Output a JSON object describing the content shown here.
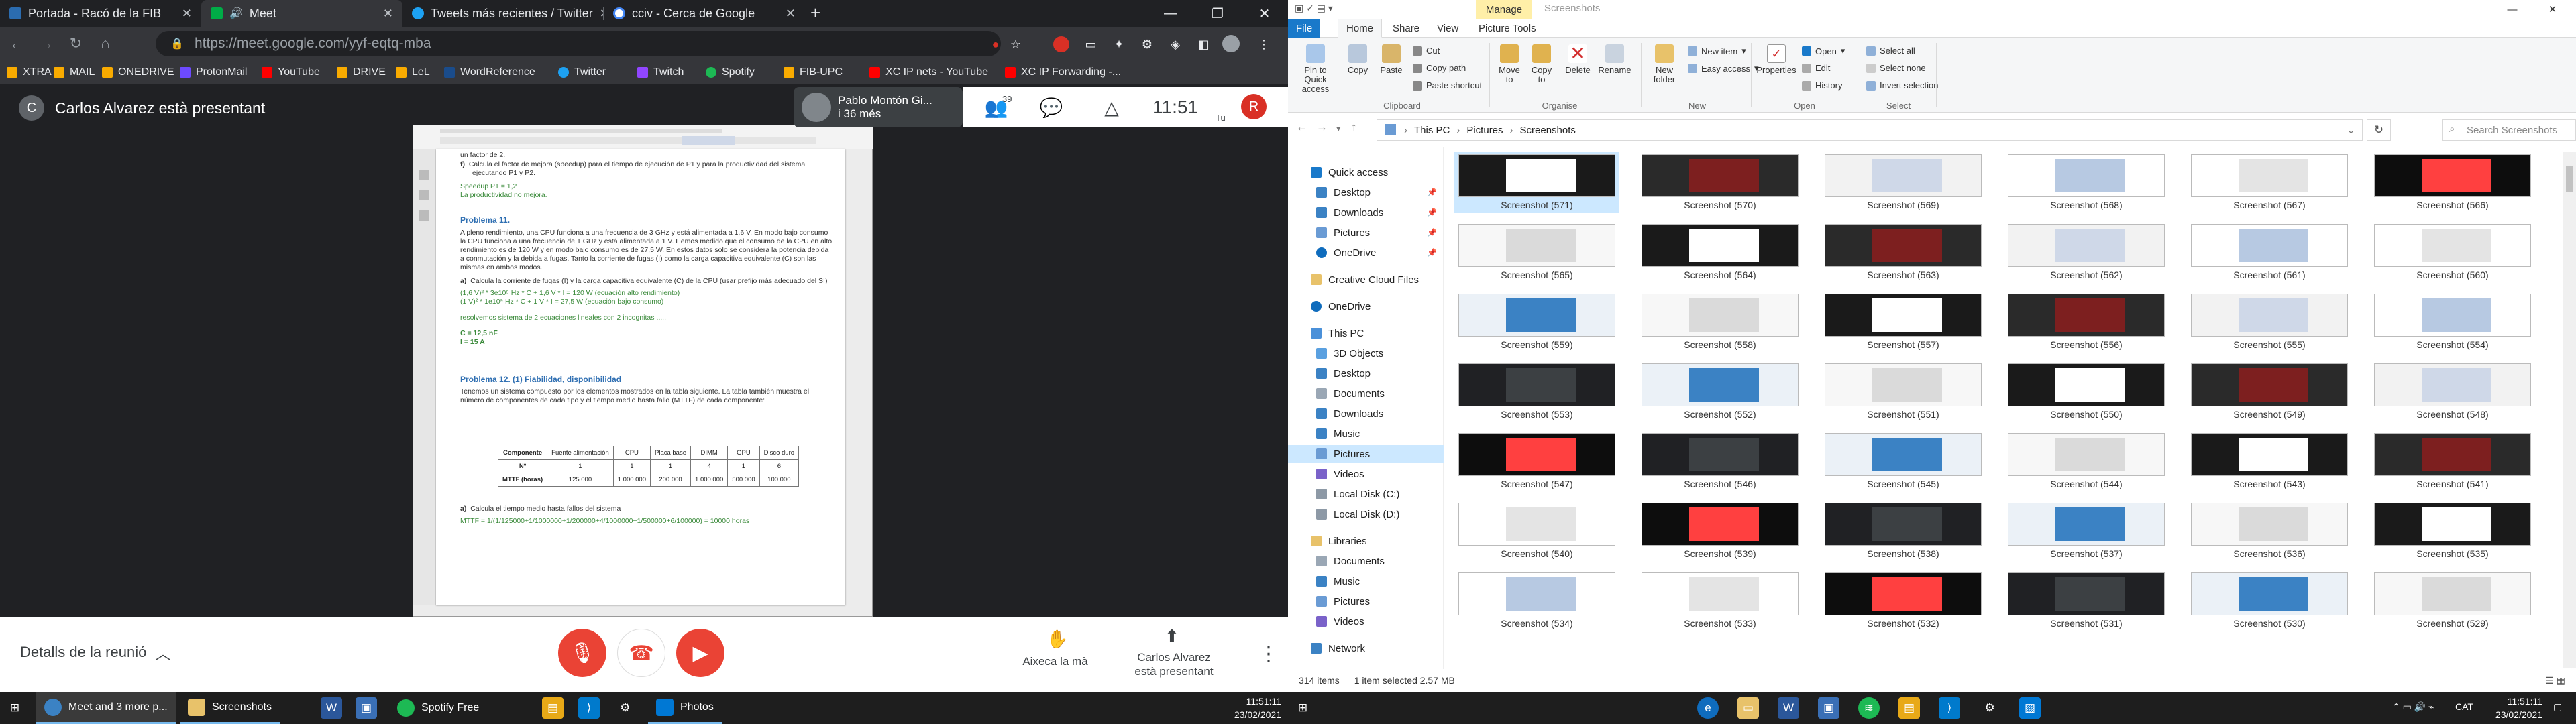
{
  "browser": {
    "tabs": [
      {
        "title": "Portada - Racó de la FIB",
        "active": false
      },
      {
        "title": "Meet",
        "active": true
      },
      {
        "title": "Tweets más recientes / Twitter",
        "active": false
      },
      {
        "title": "cciv - Cerca de Google",
        "active": false
      }
    ],
    "url": "https://meet.google.com/yyf-eqtq-mba",
    "bookmarks": [
      "XTRA",
      "MAIL",
      "ONEDRIVE",
      "ProtonMail",
      "YouTube",
      "DRIVE",
      "LeL",
      "WordReference",
      "Twitter",
      "Twitch",
      "Spotify",
      "FIB-UPC",
      "XC IP nets - YouTube",
      "XC IP Forwarding -..."
    ]
  },
  "meet": {
    "presenter_initial": "C",
    "presenting_label": "Carlos Alvarez està presentant",
    "pinned_name": "Pablo Montón Gi...",
    "pinned_sub": "i 36 més",
    "participants_count": "39",
    "time": "11:51",
    "user_initial": "R",
    "user_label": "Tu",
    "details_label": "Detalls de la reunió",
    "raise_hand_label": "Aixeca la mà",
    "presenting_btn_label": "Carlos Alvarez està presentant"
  },
  "document": {
    "lines": [
      "un factor de 2.",
      "Calcula el factor de mejora (speedup) para el tiempo de ejecución de P1 y para la productividad del sistema",
      "ejecutando P1 y P2.",
      "Speedup P1 = 1,2",
      "La productividad no mejora.",
      "Problema 11.",
      "A pleno rendimiento, una CPU funciona a una frecuencia de 3 GHz y está alimentada a 1,6 V. En modo bajo consumo",
      "la CPU funciona a una frecuencia de 1 GHz y está alimentada a 1 V. Hemos medido que el consumo de la CPU en alto",
      "rendimiento es de 120 W y en modo bajo consumo es de 27,5 W. En estos datos solo se considera la potencia debida",
      "a conmutación y la debida a fugas. Tanto la corriente de fugas (I) como la carga capacitiva equivalente (C) son las",
      "mismas en ambos modos.",
      "Calcula la corriente de fugas (I) y la carga capacitiva equivalente (C) de la CPU (usar prefijo más adecuado del SI)",
      "(1,6 V)² * 3e10⁹ Hz * C + 1,6 V * I = 120 W      (ecuación alto rendimiento)",
      "(1 V)² * 1e10⁹ Hz * C + 1 V * I = 27,5 W        (ecuación bajo consumo)",
      "resolvemos sistema de 2 ecuaciones lineales con 2 incognitas .....",
      "C = 12,5 nF",
      "I = 15 A",
      "Problema 12. (1) Fiabilidad, disponibilidad",
      "Tenemos un sistema compuesto por los elementos mostrados en la tabla siguiente. La tabla también muestra el",
      "número de componentes de cada tipo y el tiempo medio hasta fallo (MTTF) de cada componente:",
      "Calcula el tiempo medio hasta fallos del sistema",
      "MTTF = 1/(1/125000+1/1000000+1/200000+4/1000000+1/500000+6/100000) = 10000 horas"
    ],
    "table": {
      "headers": [
        "Componente",
        "Fuente alimentación",
        "CPU",
        "Placa base",
        "DIMM",
        "GPU",
        "Disco duro"
      ],
      "rows": [
        [
          "Nº",
          "1",
          "1",
          "1",
          "4",
          "1",
          "6"
        ],
        [
          "MTTF (horas)",
          "125.000",
          "1.000.000",
          "200.000",
          "1.000.000",
          "500.000",
          "100.000"
        ]
      ]
    }
  },
  "explorer": {
    "manage_label": "Manage",
    "window_title": "Screenshots",
    "ribbon_tabs": [
      "File",
      "Home",
      "Share",
      "View",
      "Picture Tools"
    ],
    "ribbon": {
      "pin": "Pin to Quick access",
      "copy": "Copy",
      "paste": "Paste",
      "cut": "Cut",
      "copy_path": "Copy path",
      "paste_shortcut": "Paste shortcut",
      "move_to": "Move to",
      "copy_to": "Copy to",
      "delete": "Delete",
      "rename": "Rename",
      "new_folder": "New folder",
      "new_item": "New item",
      "easy_access": "Easy access",
      "properties": "Properties",
      "open": "Open",
      "edit": "Edit",
      "history": "History",
      "select_all": "Select all",
      "select_none": "Select none",
      "invert_selection": "Invert selection",
      "groups": [
        "Clipboard",
        "Organise",
        "New",
        "Open",
        "Select"
      ]
    },
    "breadcrumb": [
      "This PC",
      "Pictures",
      "Screenshots"
    ],
    "search_placeholder": "Search Screenshots",
    "nav": [
      "Quick access",
      "Desktop",
      "Downloads",
      "Pictures",
      "OneDrive",
      "Creative Cloud Files",
      "OneDrive",
      "This PC",
      "3D Objects",
      "Desktop",
      "Documents",
      "Downloads",
      "Music",
      "Pictures",
      "Videos",
      "Local Disk (C:)",
      "Local Disk (D:)",
      "Libraries",
      "Documents",
      "Music",
      "Pictures",
      "Videos",
      "Network"
    ],
    "files": [
      "Screenshot (571)",
      "Screenshot (570)",
      "Screenshot (569)",
      "Screenshot (568)",
      "Screenshot (567)",
      "Screenshot (566)",
      "Screenshot (565)",
      "Screenshot (564)",
      "Screenshot (563)",
      "Screenshot (562)",
      "Screenshot (561)",
      "Screenshot (560)",
      "Screenshot (559)",
      "Screenshot (558)",
      "Screenshot (557)",
      "Screenshot (556)",
      "Screenshot (555)",
      "Screenshot (554)",
      "Screenshot (553)",
      "Screenshot (552)",
      "Screenshot (551)",
      "Screenshot (550)",
      "Screenshot (549)",
      "Screenshot (548)",
      "Screenshot (547)",
      "Screenshot (546)",
      "Screenshot (545)",
      "Screenshot (544)",
      "Screenshot (543)",
      "Screenshot (541)",
      "Screenshot (540)",
      "Screenshot (539)",
      "Screenshot (538)",
      "Screenshot (537)",
      "Screenshot (536)",
      "Screenshot (535)",
      "Screenshot (534)",
      "Screenshot (533)",
      "Screenshot (532)",
      "Screenshot (531)",
      "Screenshot (530)",
      "Screenshot (529)"
    ],
    "status_count": "314 items",
    "status_selected": "1 item selected  2.57 MB"
  },
  "taskbar_left": {
    "apps": [
      "Meet and 3 more p...",
      "Screenshots",
      "Spotify Free",
      "Photos"
    ],
    "time": "11:51:11",
    "date": "23/02/2021"
  },
  "taskbar_right": {
    "lang": "CAT",
    "time": "11:51:11",
    "date": "23/02/2021"
  }
}
